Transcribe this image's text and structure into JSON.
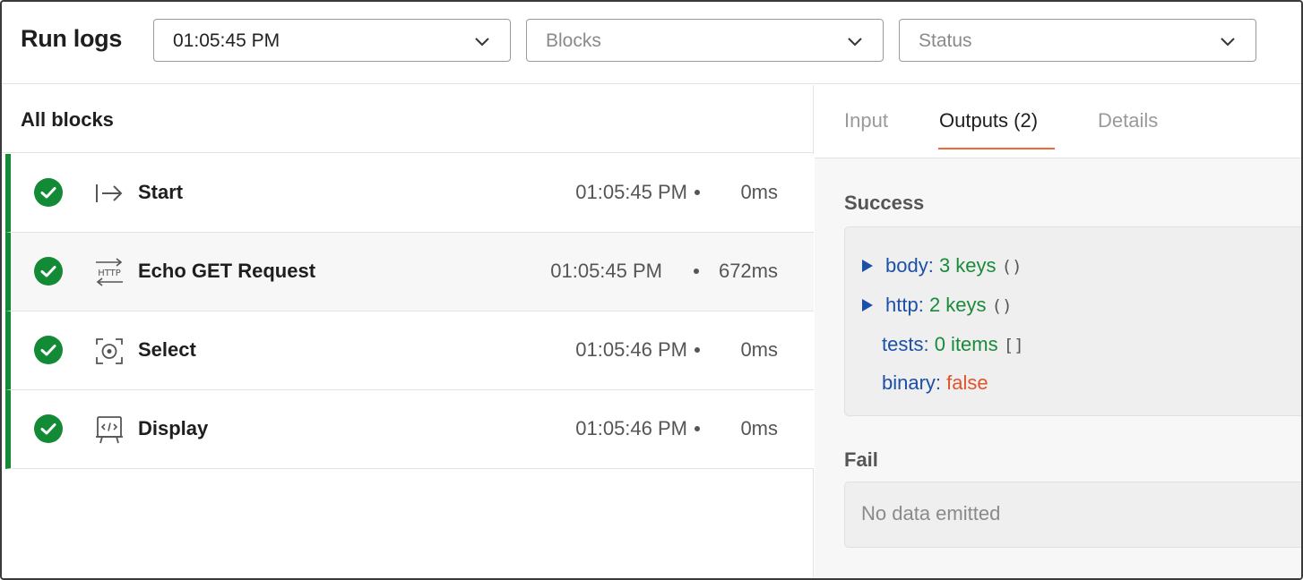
{
  "header": {
    "title": "Run logs",
    "run_select": {
      "value": "01:05:45 PM"
    },
    "blocks_select": {
      "placeholder": "Blocks"
    },
    "status_select": {
      "placeholder": "Status"
    }
  },
  "blocks_panel": {
    "heading": "All blocks",
    "rows": [
      {
        "name": "Start",
        "icon": "start-arrow-icon",
        "time": "01:05:45 PM",
        "duration": "0ms",
        "status": "success"
      },
      {
        "name": "Echo GET Request",
        "icon": "http-icon",
        "time": "01:05:45 PM",
        "duration": "672ms",
        "status": "success",
        "selected": true
      },
      {
        "name": "Select",
        "icon": "select-target-icon",
        "time": "01:05:46 PM",
        "duration": "0ms",
        "status": "success"
      },
      {
        "name": "Display",
        "icon": "display-code-icon",
        "time": "01:05:46 PM",
        "duration": "0ms",
        "status": "success"
      }
    ]
  },
  "details_panel": {
    "tabs": [
      {
        "label": "Input",
        "active": false
      },
      {
        "label": "Outputs (2)",
        "active": true
      },
      {
        "label": "Details",
        "active": false
      }
    ],
    "success_label": "Success",
    "outputs": [
      {
        "key": "body:",
        "value": "3 keys",
        "suffix": "()",
        "expandable": true
      },
      {
        "key": "http:",
        "value": "2 keys",
        "suffix": "()",
        "expandable": true
      },
      {
        "key": "tests:",
        "value": "0 items",
        "suffix": "[]",
        "expandable": false
      },
      {
        "key": "binary:",
        "value": "false",
        "suffix": "",
        "expandable": false
      }
    ],
    "fail_label": "Fail",
    "fail_empty": "No data emitted"
  },
  "colors": {
    "success_green": "#138a36",
    "tab_accent": "#f06a35",
    "key_blue": "#1b4fa8",
    "value_green": "#1a8a3a",
    "bool_red": "#e0532b"
  }
}
